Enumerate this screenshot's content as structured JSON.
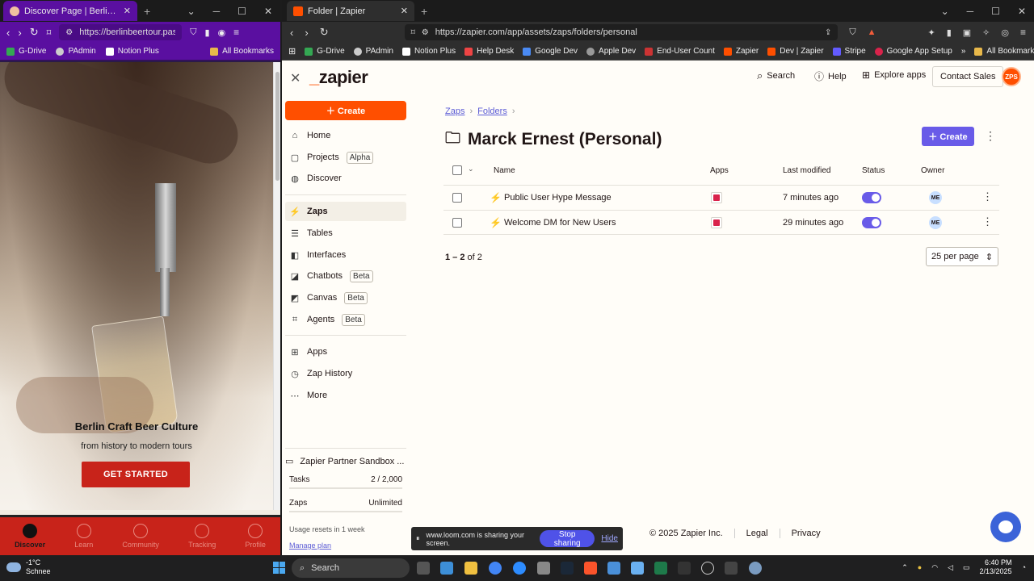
{
  "left_window": {
    "tab_title": "Discover Page | Berlin Beer Tour",
    "url": "https://berlinbeertour.passi...",
    "bookmarks": [
      "G-Drive",
      "PAdmin",
      "Notion Plus",
      "All Bookmarks"
    ],
    "hero": {
      "title": "Berlin Craft Beer Culture",
      "subtitle": "from history to modern tours",
      "cta": "GET STARTED"
    },
    "bottom_nav": [
      "Discover",
      "Learn",
      "Community",
      "Tracking",
      "Profile"
    ],
    "colors": {
      "chrome": "#5a0fa0",
      "brand_red": "#c8231a"
    }
  },
  "right_window": {
    "tab_title": "Folder | Zapier",
    "url": "https://zapier.com/app/assets/zaps/folders/personal",
    "bookmarks": [
      "G-Drive",
      "PAdmin",
      "Notion Plus",
      "Help Desk",
      "Google Dev",
      "Apple Dev",
      "End-User Count",
      "Zapier",
      "Dev | Zapier",
      "Stripe",
      "Google App Setup",
      "All Bookmarks"
    ]
  },
  "zapier": {
    "logo": "zapier",
    "header": {
      "search": "Search",
      "help": "Help",
      "explore": "Explore apps",
      "contact": "Contact Sales",
      "avatar": "ZPS"
    },
    "sidebar": {
      "create": "Create",
      "items": [
        {
          "label": "Home",
          "icon": "home-icon",
          "pill": ""
        },
        {
          "label": "Projects",
          "icon": "projects-icon",
          "pill": "Alpha"
        },
        {
          "label": "Discover",
          "icon": "globe-icon",
          "pill": ""
        },
        {
          "label": "Zaps",
          "icon": "bolt-icon",
          "pill": ""
        },
        {
          "label": "Tables",
          "icon": "tables-icon",
          "pill": ""
        },
        {
          "label": "Interfaces",
          "icon": "interfaces-icon",
          "pill": ""
        },
        {
          "label": "Chatbots",
          "icon": "chatbot-icon",
          "pill": "Beta"
        },
        {
          "label": "Canvas",
          "icon": "canvas-icon",
          "pill": "Beta"
        },
        {
          "label": "Agents",
          "icon": "agents-icon",
          "pill": "Beta"
        },
        {
          "label": "Apps",
          "icon": "apps-icon",
          "pill": ""
        },
        {
          "label": "Zap History",
          "icon": "history-icon",
          "pill": ""
        },
        {
          "label": "More",
          "icon": "more-icon",
          "pill": ""
        }
      ],
      "account": {
        "name": "Zapier Partner Sandbox ...",
        "tasks_label": "Tasks",
        "tasks_value": "2 / 2,000",
        "zaps_label": "Zaps",
        "zaps_value": "Unlimited",
        "reset": "Usage resets in 1 week",
        "manage": "Manage plan"
      }
    },
    "breadcrumb": [
      "Zaps",
      "Folders"
    ],
    "title": "Marck Ernest (Personal)",
    "create": "Create",
    "table": {
      "headers": [
        "Name",
        "Apps",
        "Last modified",
        "Status",
        "Owner"
      ],
      "rows": [
        {
          "name": "Public User Hype Message",
          "modified": "7 minutes ago",
          "owner": "ME",
          "status_on": true
        },
        {
          "name": "Welcome DM for New Users",
          "modified": "29 minutes ago",
          "owner": "ME",
          "status_on": true
        }
      ]
    },
    "pagination": {
      "range": "1 – 2",
      "of": "of 2"
    },
    "per_page": "25 per page",
    "footer": {
      "copyright": "© 2025 Zapier Inc.",
      "legal": "Legal",
      "privacy": "Privacy"
    },
    "colors": {
      "accent": "#ff4f00",
      "primary": "#695be8"
    }
  },
  "loom": {
    "message": "www.loom.com is sharing your screen.",
    "stop": "Stop sharing",
    "hide": "Hide"
  },
  "taskbar": {
    "weather_temp": "-1°C",
    "weather_desc": "Schnee",
    "search": "Search",
    "time": "6:40 PM",
    "date": "2/13/2025"
  }
}
